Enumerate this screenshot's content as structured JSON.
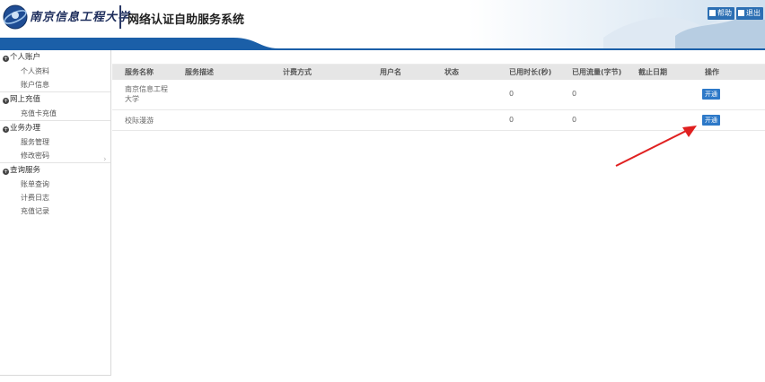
{
  "header": {
    "university_logo_text": "南京信息工程大学",
    "system_title": "网络认证自助服务系统",
    "help_label": "帮助",
    "exit_label": "退出"
  },
  "sidebar": {
    "groups": [
      {
        "title": "个人账户",
        "items": [
          "个人资料",
          "账户信息"
        ]
      },
      {
        "title": "网上充值",
        "items": [
          "充值卡充值"
        ]
      },
      {
        "title": "业务办理",
        "items": [
          "服务管理",
          "修改密码"
        ]
      },
      {
        "title": "查询服务",
        "items": [
          "账单查询",
          "计费日志",
          "充值记录"
        ]
      }
    ]
  },
  "table": {
    "headers": [
      "服务名称",
      "服务描述",
      "计费方式",
      "用户名",
      "状态",
      "已用时长(秒)",
      "已用流量(字节)",
      "截止日期",
      "操作"
    ],
    "rows": [
      {
        "service_name_line1": "南京信息工程",
        "service_name_line2": "大学",
        "used_time": "0",
        "used_traffic": "0",
        "action": "开通"
      },
      {
        "service_name_line1": "校际漫游",
        "service_name_line2": "",
        "used_time": "0",
        "used_traffic": "0",
        "action": "开通"
      }
    ]
  },
  "colors": {
    "header_band": "#1b5fa8",
    "button_blue": "#2d79c8",
    "annotation_arrow": "#e02020"
  },
  "icons": [
    "university-emblem-icon",
    "help-icon",
    "exit-icon",
    "circle-bullet-icon",
    "chevron-right-icon"
  ]
}
